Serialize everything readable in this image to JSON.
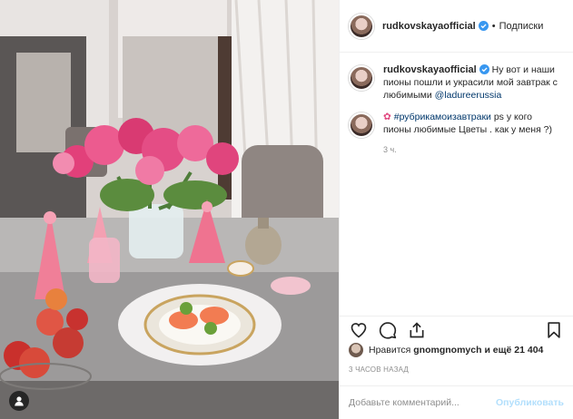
{
  "post": {
    "username": "rudkovskayaofficial",
    "follow_label": "Подписки",
    "separator": "•",
    "caption": {
      "username": "rudkovskayaofficial",
      "text_before_mention": " Ну вот и наши пионы пошли и украсили мой завтрак с любимыми ",
      "mention": "@ladureerussia",
      "hashtag": "#рубрикамоизавтраки",
      "text_after_hashtag": " ps у кого пионы любимые Цветы . как у меня ?)"
    },
    "caption_time": "3 ч."
  },
  "likes": {
    "prefix": "Нравится ",
    "user": "gnomgnomych",
    "suffix": " и ещё 21 404"
  },
  "timestamp": "3 ЧАСОВ НАЗАД",
  "comment_box": {
    "placeholder": "Добавьте комментарий...",
    "publish_label": "Опубликовать"
  },
  "icons": {
    "verified": "verified-badge-icon",
    "like": "heart-icon",
    "comment": "comment-icon",
    "share": "share-icon",
    "save": "bookmark-icon",
    "profile": "user-icon"
  },
  "colors": {
    "verified": "#3897f0",
    "link": "#00376b",
    "publish_disabled": "#b2dffc"
  }
}
